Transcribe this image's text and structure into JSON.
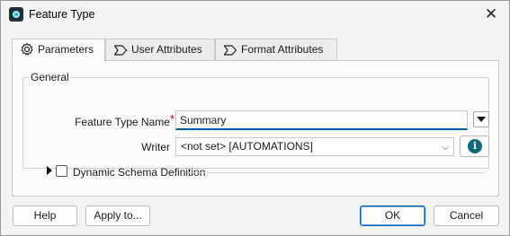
{
  "window": {
    "title": "Feature Type",
    "close_glyph": "✕"
  },
  "tabs": [
    {
      "label": "Parameters",
      "icon": "gear-icon",
      "active": true
    },
    {
      "label": "User Attributes",
      "icon": "tag-icon",
      "active": false
    },
    {
      "label": "Format Attributes",
      "icon": "tag-icon",
      "active": false
    }
  ],
  "general": {
    "legend": "General",
    "feature_type_name": {
      "label": "Feature Type Name",
      "required_mark": "*",
      "value": "Summary"
    },
    "writer": {
      "label": "Writer",
      "value": "<not set> [AUTOMATIONS]",
      "chevron": "⌵"
    },
    "info_glyph": "i",
    "dynamic_schema": {
      "label": "Dynamic Schema Definition",
      "checked": false,
      "expanded": false
    }
  },
  "footer": {
    "help_label": "Help",
    "apply_label": "Apply to...",
    "ok_label": "OK",
    "cancel_label": "Cancel"
  },
  "colors": {
    "accent": "#005fb8",
    "info_button": "#0f6a7a",
    "required": "#cc0000"
  }
}
